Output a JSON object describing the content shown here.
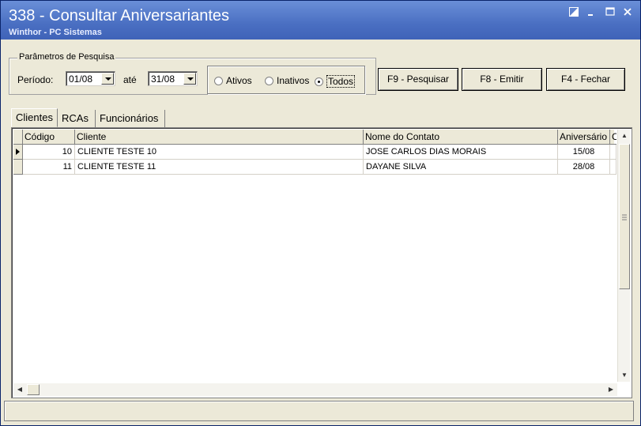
{
  "window": {
    "title": "338 - Consultar Aniversariantes",
    "subtitle": "Winthor - PC Sistemas"
  },
  "search": {
    "group_title": "Parâmetros de Pesquisa",
    "period_label": "Período:",
    "date_from": "01/08",
    "until_label": "até",
    "date_to": "31/08",
    "radios": [
      {
        "label": "Ativos",
        "checked": false
      },
      {
        "label": "Inativos",
        "checked": false
      },
      {
        "label": "Todos",
        "checked": true
      }
    ]
  },
  "buttons": {
    "search": "F9 - Pesquisar",
    "emit": "F8 - Emitir",
    "close": "F4 - Fechar"
  },
  "tabs": [
    "Clientes",
    "RCAs",
    "Funcionários"
  ],
  "grid": {
    "columns": [
      "Código",
      "Cliente",
      "Nome do Contato",
      "Aniversário",
      "C"
    ],
    "rows": [
      {
        "codigo": "10",
        "cliente": "CLIENTE TESTE 10",
        "contato": "JOSE CARLOS DIAS MORAIS",
        "aniversario": "15/08"
      },
      {
        "codigo": "11",
        "cliente": "CLIENTE TESTE 11",
        "contato": "DAYANE SILVA",
        "aniversario": "28/08"
      }
    ]
  }
}
